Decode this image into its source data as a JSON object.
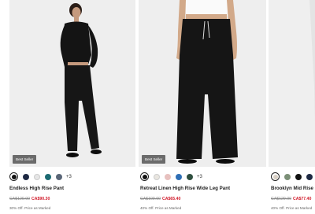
{
  "products": [
    {
      "badge": "Best Seller",
      "name": "Endless High Rise Pant",
      "original_price": "CA$129.00",
      "sale_price": "CA$90.30",
      "promo": "30% Off. Price as Marked",
      "more_colors": "+3",
      "swatches": [
        "#111111",
        "#1f2a44",
        "#e6e6e6",
        "#1d6b73",
        "#5a6677"
      ]
    },
    {
      "badge": "Best Seller",
      "name": "Retreat Linen High Rise Wide Leg Pant",
      "original_price": "CA$109.00",
      "sale_price": "CA$65.40",
      "promo": "40% Off. Price as Marked",
      "more_colors": "+3",
      "swatches": [
        "#111111",
        "#e9e6e0",
        "#e7c1bf",
        "#2f6fb5",
        "#2f4f3f"
      ]
    },
    {
      "name": "Brooklyn Mid Rise",
      "original_price": "CA$129.00",
      "sale_price": "CA$77.40",
      "promo": "40% Off. Price as Marked",
      "swatches": [
        "#d8cfc4",
        "#7b8f77",
        "#111111",
        "#1f2a44"
      ]
    }
  ],
  "colors": {
    "sale_red": "#d11a2a",
    "photo_bg": "#eeeeee"
  }
}
